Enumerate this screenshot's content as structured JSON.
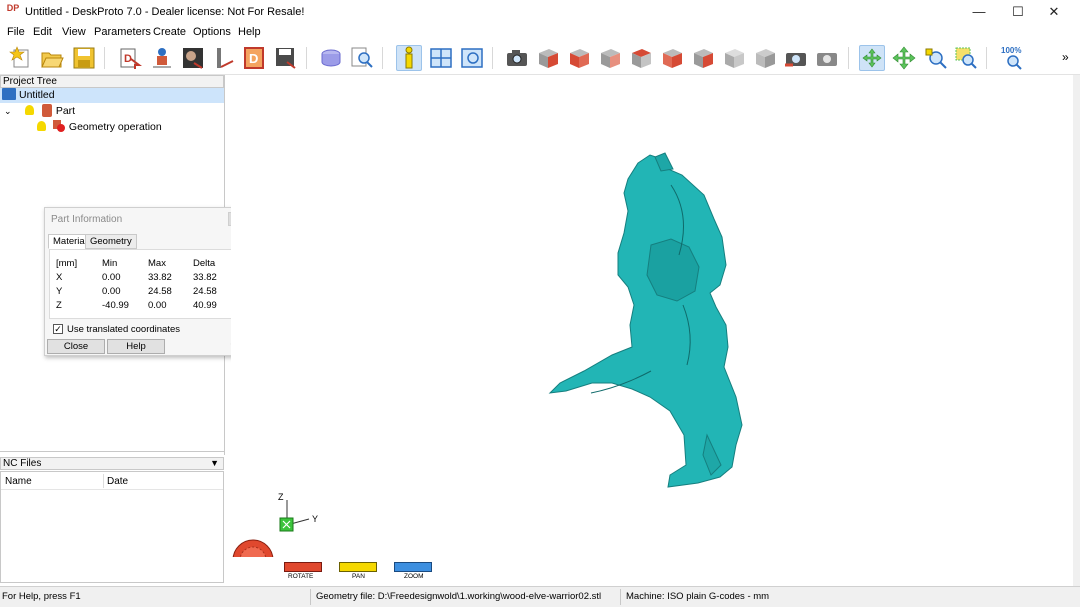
{
  "app": {
    "title": "Untitled - DeskProto 7.0 - Dealer license: Not For Resale!",
    "icon_label": "DP"
  },
  "window_controls": {
    "minimize": "—",
    "maximize": "☐",
    "close": "✕"
  },
  "menu": [
    "File",
    "Edit",
    "View",
    "Parameters",
    "Create",
    "Options",
    "Help"
  ],
  "toolbar": {
    "icons": [
      "new-project-icon",
      "open-icon",
      "save-icon",
      "import-geometry-icon",
      "import-part-icon",
      "import-bitmap-icon",
      "import-vector-icon",
      "dxf-icon",
      "save-geometry-icon",
      "cylinder-view-icon",
      "search-icon",
      "info-icon",
      "layout-icon",
      "view-window-icon",
      "camera-icon",
      "view-front-icon",
      "view-right-icon",
      "view-back-icon",
      "view-left-icon",
      "view-top-icon",
      "view-bottom-icon",
      "view-iso-icon",
      "view-iso2-icon",
      "snapshot-icon",
      "snapshot2-icon",
      "rotate-mode-icon",
      "pan-mode-icon",
      "zoom-in-icon",
      "zoom-window-icon",
      "zoom-100-icon"
    ],
    "zoom_100_label": "100%",
    "overflow": "»"
  },
  "project_tree": {
    "header": "Project Tree",
    "root": "Untitled",
    "part": "Part",
    "operation": "Geometry operation"
  },
  "part_info": {
    "title": "Part Information",
    "tabs": [
      "Material",
      "Geometry"
    ],
    "unit": "[mm]",
    "columns": [
      "Min",
      "Max",
      "Delta"
    ],
    "rows": [
      {
        "axis": "X",
        "min": "0.00",
        "max": "33.82",
        "delta": "33.82"
      },
      {
        "axis": "Y",
        "min": "0.00",
        "max": "24.58",
        "delta": "24.58"
      },
      {
        "axis": "Z",
        "min": "-40.99",
        "max": "0.00",
        "delta": "40.99"
      }
    ],
    "checkbox_label": "Use translated coordinates",
    "checkbox_checked": true,
    "close_button": "Close",
    "help_button": "Help"
  },
  "nc_files": {
    "header": "NC Files",
    "columns": [
      "Name",
      "Date"
    ]
  },
  "viewport": {
    "axes": {
      "z": "Z",
      "y": "Y"
    },
    "model_color": "#22b5b5",
    "controls": [
      "ROTATE",
      "PAN",
      "ZOOM"
    ]
  },
  "status": {
    "help": "For Help, press F1",
    "geometry_file": "Geometry file: D:\\Freedesignwold\\1.working\\wood-elve-warrior02.stl",
    "machine": "Machine: ISO plain G-codes - mm"
  }
}
